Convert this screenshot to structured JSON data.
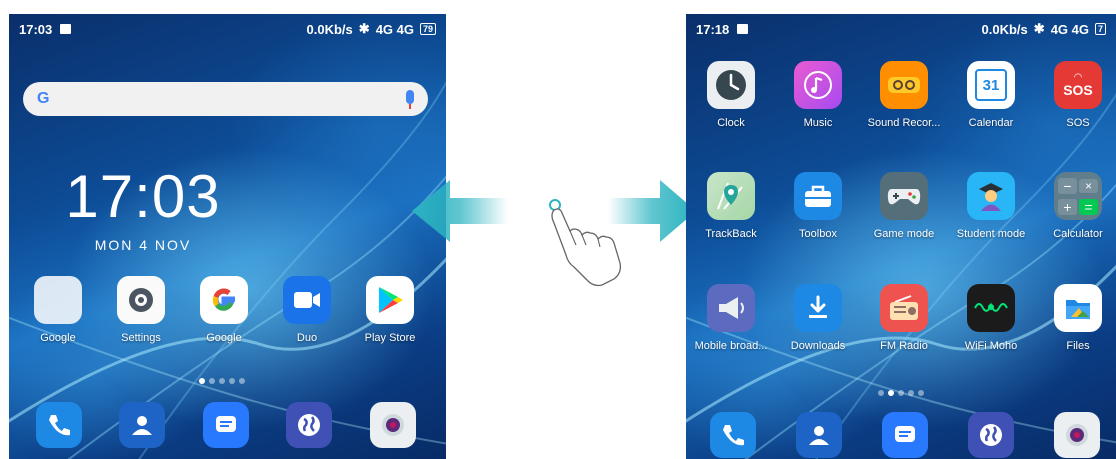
{
  "left_screen": {
    "status": {
      "time": "17:03",
      "net": "0.0Kb/s",
      "signal": "4G 4G",
      "battery": "79"
    },
    "search": {
      "logo": "G"
    },
    "clock": {
      "time": "17:03",
      "date": "MON 4 NOV"
    },
    "apps": [
      {
        "label": "Google",
        "icon": "google-folder-icon"
      },
      {
        "label": "Settings",
        "icon": "settings-gear-icon"
      },
      {
        "label": "Google",
        "icon": "google-g-icon"
      },
      {
        "label": "Duo",
        "icon": "duo-video-icon"
      },
      {
        "label": "Play Store",
        "icon": "play-store-icon"
      }
    ],
    "dock": [
      "phone-icon",
      "contacts-icon",
      "messages-icon",
      "browser-globe-icon",
      "camera-icon"
    ]
  },
  "right_screen": {
    "status": {
      "time": "17:18",
      "net": "0.0Kb/s",
      "signal": "4G 4G",
      "battery": "7"
    },
    "apps": [
      {
        "label": "Clock",
        "icon": "clock-icon"
      },
      {
        "label": "Music",
        "icon": "music-note-icon"
      },
      {
        "label": "Sound Recor...",
        "icon": "sound-recorder-icon"
      },
      {
        "label": "Calendar",
        "icon": "calendar-icon",
        "day": "31"
      },
      {
        "label": "SOS",
        "icon": "sos-icon",
        "text": "SOS"
      },
      {
        "label": "TrackBack",
        "icon": "trackback-map-icon"
      },
      {
        "label": "Toolbox",
        "icon": "toolbox-icon"
      },
      {
        "label": "Game mode",
        "icon": "gamepad-icon"
      },
      {
        "label": "Student mode",
        "icon": "student-icon"
      },
      {
        "label": "Calculator",
        "icon": "calculator-icon"
      },
      {
        "label": "Mobile broad...",
        "icon": "broadcast-megaphone-icon"
      },
      {
        "label": "Downloads",
        "icon": "download-icon"
      },
      {
        "label": "FM Radio",
        "icon": "radio-icon"
      },
      {
        "label": "WiFi Moho",
        "icon": "wifi-moho-icon"
      },
      {
        "label": "Files",
        "icon": "files-icon"
      }
    ],
    "dock": [
      "phone-icon",
      "contacts-icon",
      "messages-icon",
      "browser-globe-icon",
      "camera-icon"
    ]
  },
  "colors": {
    "arrow": "#2bb3c0",
    "wallpaper_dark": "#0a2f6b",
    "wallpaper_light": "#78dcff"
  }
}
